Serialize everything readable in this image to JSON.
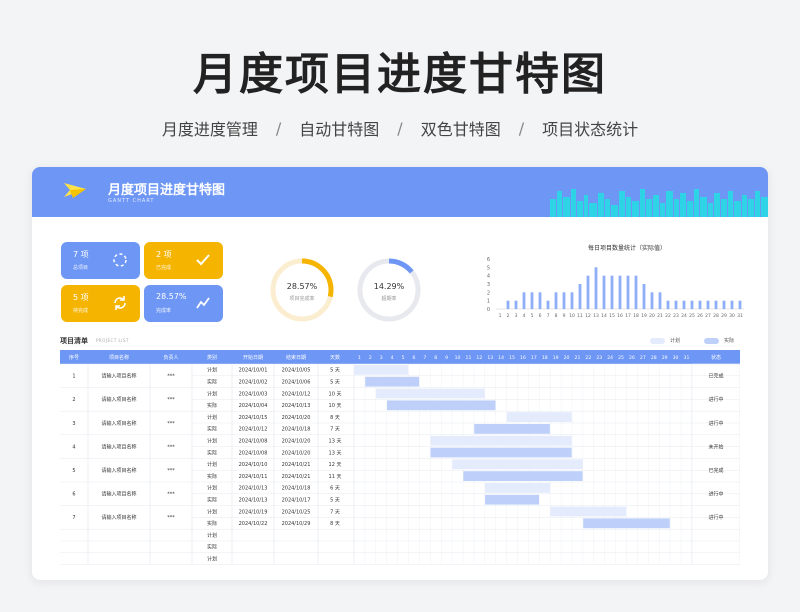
{
  "page": {
    "title": "月度项目进度甘特图"
  },
  "subnav": [
    "月度进度管理",
    "自动甘特图",
    "双色甘特图",
    "项目状态统计"
  ],
  "banner": {
    "title": "月度项目进度甘特图",
    "subtitle": "GANTT CHART"
  },
  "stats": [
    {
      "value": "7 项",
      "label": "总项目",
      "icon": "refresh-dots-icon",
      "color": "blue"
    },
    {
      "value": "2 项",
      "label": "已完成",
      "icon": "check-icon",
      "color": "yellow"
    },
    {
      "value": "5 项",
      "label": "待完成",
      "icon": "cycle-arrows-icon",
      "color": "yellow"
    },
    {
      "value": "28.57%",
      "label": "完成率",
      "icon": "trend-icon",
      "color": "blue"
    }
  ],
  "rings": [
    {
      "value": "28.57%",
      "label": "项目完成率",
      "fraction": 0.2857,
      "color": "#f5b400"
    },
    {
      "value": "14.29%",
      "label": "超期率",
      "fraction": 0.1429,
      "color": "#6d96f5"
    }
  ],
  "colors": {
    "accent": "#6d96f5",
    "yellow": "#f5b400",
    "plan": "#e3ebfd",
    "actual": "#bed0fa"
  },
  "chart_data": {
    "type": "bar",
    "title": "每日项目数量统计（实际值）",
    "categories": [
      "1",
      "2",
      "3",
      "4",
      "5",
      "6",
      "7",
      "8",
      "9",
      "10",
      "11",
      "12",
      "13",
      "14",
      "15",
      "16",
      "17",
      "18",
      "19",
      "20",
      "21",
      "22",
      "23",
      "24",
      "25",
      "26",
      "27",
      "28",
      "29",
      "30",
      "31"
    ],
    "values": [
      0,
      1,
      1,
      2,
      2,
      2,
      1,
      2,
      2,
      2,
      3,
      4,
      5,
      4,
      4,
      4,
      4,
      4,
      3,
      2,
      2,
      1,
      1,
      1,
      1,
      1,
      1,
      1,
      1,
      1,
      1
    ],
    "yticks": [
      "0",
      "1",
      "2",
      "3",
      "4",
      "5",
      "6"
    ],
    "ylim": [
      0,
      6
    ]
  },
  "list": {
    "title": "项目清单",
    "subtitle": "PROJECT LIST",
    "legend_plan": "计划",
    "legend_actual": "实际"
  },
  "table": {
    "headers": [
      "序号",
      "项目名称",
      "负责人",
      "类别",
      "开始日期",
      "结束日期",
      "天数",
      "状态"
    ],
    "days": [
      "1",
      "2",
      "3",
      "4",
      "5",
      "6",
      "7",
      "8",
      "9",
      "10",
      "11",
      "12",
      "13",
      "14",
      "15",
      "16",
      "17",
      "18",
      "19",
      "20",
      "21",
      "22",
      "23",
      "24",
      "25",
      "26",
      "27",
      "28",
      "29",
      "30",
      "31"
    ],
    "projects": [
      {
        "no": "1",
        "name": "请输入项目名称",
        "owner": "***",
        "status": "已完成",
        "plan": {
          "type": "计划",
          "start": "2024/10/01",
          "end": "2024/10/05",
          "days": "5 天"
        },
        "actual": {
          "type": "实际",
          "start": "2024/10/02",
          "end": "2024/10/06",
          "days": "5 天"
        }
      },
      {
        "no": "2",
        "name": "请输入项目名称",
        "owner": "***",
        "status": "进行中",
        "plan": {
          "type": "计划",
          "start": "2024/10/03",
          "end": "2024/10/12",
          "days": "10 天"
        },
        "actual": {
          "type": "实际",
          "start": "2024/10/04",
          "end": "2024/10/13",
          "days": "10 天"
        }
      },
      {
        "no": "3",
        "name": "请输入项目名称",
        "owner": "***",
        "status": "进行中",
        "plan": {
          "type": "计划",
          "start": "2024/10/15",
          "end": "2024/10/20",
          "days": "8 天"
        },
        "actual": {
          "type": "实际",
          "start": "2024/10/12",
          "end": "2024/10/18",
          "days": "7 天"
        }
      },
      {
        "no": "4",
        "name": "请输入项目名称",
        "owner": "***",
        "status": "未开始",
        "plan": {
          "type": "计划",
          "start": "2024/10/08",
          "end": "2024/10/20",
          "days": "13 天"
        },
        "actual": {
          "type": "实际",
          "start": "2024/10/08",
          "end": "2024/10/20",
          "days": "13 天"
        }
      },
      {
        "no": "5",
        "name": "请输入项目名称",
        "owner": "***",
        "status": "已完成",
        "plan": {
          "type": "计划",
          "start": "2024/10/10",
          "end": "2024/10/21",
          "days": "12 天"
        },
        "actual": {
          "type": "实际",
          "start": "2024/10/11",
          "end": "2024/10/21",
          "days": "11 天"
        }
      },
      {
        "no": "6",
        "name": "请输入项目名称",
        "owner": "***",
        "status": "进行中",
        "plan": {
          "type": "计划",
          "start": "2024/10/13",
          "end": "2024/10/18",
          "days": "6 天"
        },
        "actual": {
          "type": "实际",
          "start": "2024/10/13",
          "end": "2024/10/17",
          "days": "5 天"
        }
      },
      {
        "no": "7",
        "name": "请输入项目名称",
        "owner": "***",
        "status": "进行中",
        "plan": {
          "type": "计划",
          "start": "2024/10/19",
          "end": "2024/10/25",
          "days": "7 天"
        },
        "actual": {
          "type": "实际",
          "start": "2024/10/22",
          "end": "2024/10/29",
          "days": "8 天"
        }
      }
    ],
    "empty_types": [
      "计划",
      "实际",
      "计划"
    ]
  }
}
